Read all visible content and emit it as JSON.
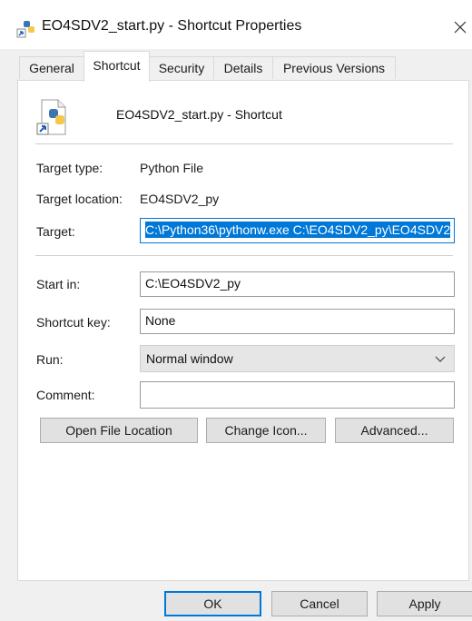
{
  "window": {
    "title": "EO4SDV2_start.py - Shortcut Properties"
  },
  "tabs": [
    {
      "label": "General"
    },
    {
      "label": "Shortcut"
    },
    {
      "label": "Security"
    },
    {
      "label": "Details"
    },
    {
      "label": "Previous Versions"
    }
  ],
  "active_tab": "Shortcut",
  "header": {
    "name": "EO4SDV2_start.py - Shortcut"
  },
  "fields": {
    "target_type": {
      "label": "Target type:",
      "value": "Python File"
    },
    "target_location": {
      "label": "Target location:",
      "value": "EO4SDV2_py"
    },
    "target": {
      "label": "Target:",
      "value": "C:\\Python36\\pythonw.exe C:\\EO4SDV2_py\\EO4SDV2"
    },
    "start_in": {
      "label": "Start in:",
      "value": "C:\\EO4SDV2_py"
    },
    "shortcut_key": {
      "label": "Shortcut key:",
      "value": "None"
    },
    "run": {
      "label": "Run:",
      "value": "Normal window"
    },
    "comment": {
      "label": "Comment:",
      "value": ""
    }
  },
  "actions": {
    "open_file_location": "Open File Location",
    "change_icon": "Change Icon...",
    "advanced": "Advanced..."
  },
  "footer": {
    "ok": "OK",
    "cancel": "Cancel",
    "apply": "Apply"
  },
  "colors": {
    "accent": "#0078d7",
    "window_bg": "#f0f0f0",
    "panel_bg": "#ffffff"
  }
}
